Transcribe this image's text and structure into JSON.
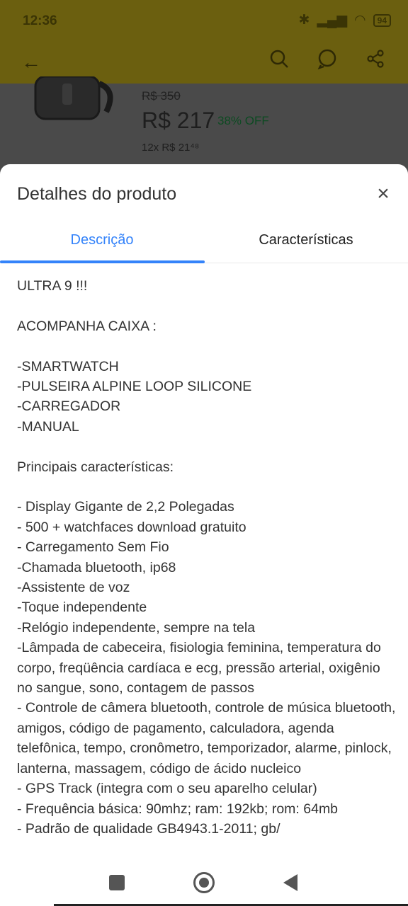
{
  "status": {
    "time": "12:36",
    "battery": "94"
  },
  "background": {
    "old_price": "R$ 350",
    "price": "R$ 217",
    "discount": "38% OFF",
    "installments": "12x R$ 21⁴⁸"
  },
  "sheet": {
    "title": "Detalhes do produto",
    "tabs": [
      "Descrição",
      "Características"
    ],
    "description": [
      "ULTRA 9 !!!",
      "",
      "ACOMPANHA CAIXA :",
      "",
      "-SMARTWATCH",
      "-PULSEIRA ALPINE LOOP SILICONE",
      "-CARREGADOR",
      "-MANUAL",
      "",
      "Principais características:",
      "",
      "- Display Gigante de 2,2 Polegadas",
      "- 500 + watchfaces download gratuito",
      "- Carregamento Sem Fio",
      "-Chamada bluetooth, ip68",
      "-Assistente de voz",
      "-Toque independente",
      "-Relógio independente, sempre na tela",
      "-Lâmpada de cabeceira, fisiologia feminina, temperatura do corpo, freqüência cardíaca e ecg, pressão arterial, oxigênio no sangue, sono, contagem de passos",
      "- Controle de câmera bluetooth, controle de música bluetooth, amigos, código de pagamento, calculadora, agenda telefônica, tempo, cronômetro, temporizador, alarme, pinlock, lanterna, massagem, código de ácido nucleico",
      "- GPS Track (integra com o seu aparelho celular)",
      "- Frequência básica: 90mhz; ram: 192kb; rom: 64mb",
      "- Padrão de qualidade GB4943.1-2011; gb/"
    ]
  },
  "colors": {
    "accent": "#3483fa",
    "header_bg": "#6b5f0f"
  }
}
